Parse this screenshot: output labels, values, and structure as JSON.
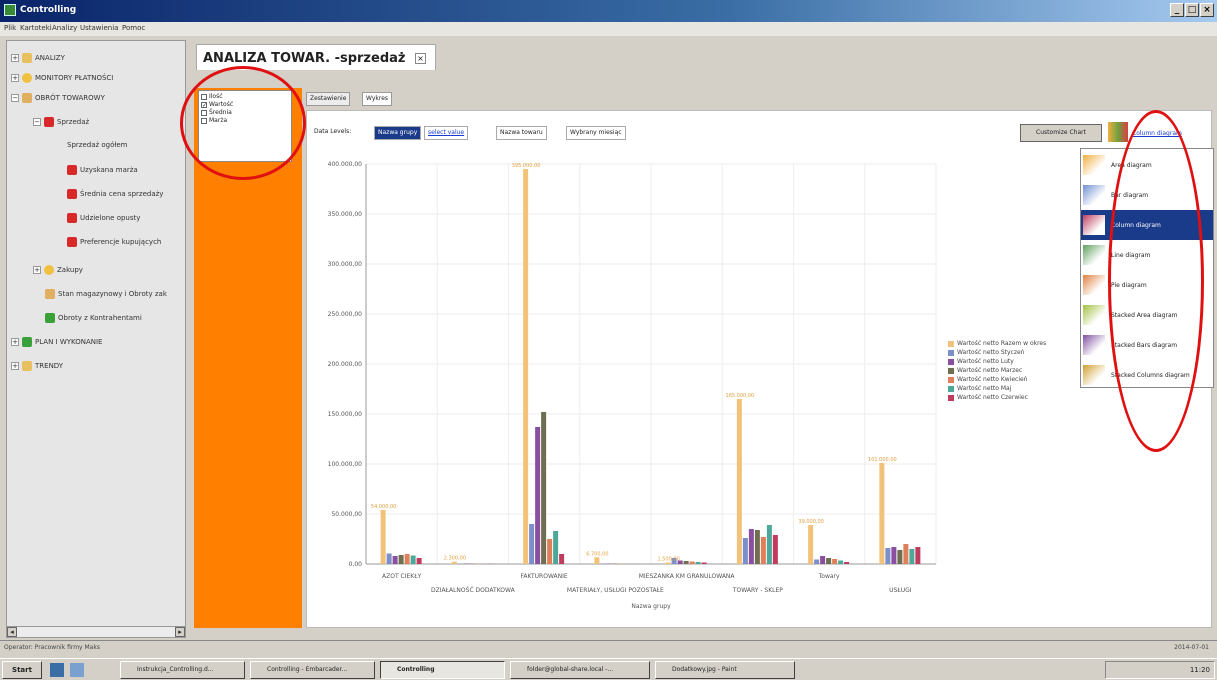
{
  "window": {
    "title": "Controlling",
    "min": "_",
    "max": "□",
    "close": "×"
  },
  "menu": [
    "Plik",
    "Kartoteki",
    "Analizy",
    "Ustawienia",
    "Pomoc"
  ],
  "tree": [
    {
      "label": "ANALIZY",
      "level": 0,
      "expand": "+",
      "icon": "chart"
    },
    {
      "label": "MONITORY PŁATNOŚCI",
      "level": 0,
      "expand": "+",
      "icon": "yellow"
    },
    {
      "label": "OBRÓT TOWAROWY",
      "level": 0,
      "expand": "−",
      "icon": "box"
    },
    {
      "label": "Sprzedaż",
      "level": 1,
      "expand": "−",
      "icon": "red"
    },
    {
      "label": "Sprzedaż ogółem",
      "level": 2,
      "expand": "",
      "icon": ""
    },
    {
      "label": "Uzyskana marża",
      "level": 2,
      "expand": "",
      "icon": "red"
    },
    {
      "label": "Średnia cena sprzedaży",
      "level": 2,
      "expand": "",
      "icon": "red"
    },
    {
      "label": "Udzielone opusty",
      "level": 2,
      "expand": "",
      "icon": "red"
    },
    {
      "label": "Preferencje kupujących",
      "level": 2,
      "expand": "",
      "icon": "red"
    },
    {
      "label": "Zakupy",
      "level": 1,
      "expand": "+",
      "icon": "yellow"
    },
    {
      "label": "Stan magazynowy i Obroty zak",
      "level": 1,
      "expand": "",
      "icon": "box"
    },
    {
      "label": "Obroty z Kontrahentami",
      "level": 1,
      "expand": "",
      "icon": "green"
    },
    {
      "label": "PLAN I WYKONANIE",
      "level": 0,
      "expand": "+",
      "icon": "green"
    },
    {
      "label": "TRENDY",
      "level": 0,
      "expand": "+",
      "icon": "chart"
    }
  ],
  "tab": {
    "title": "ANALIZA TOWAR. -sprzedaż",
    "close": "×"
  },
  "checkboxes": [
    {
      "label": "Ilość",
      "checked": false
    },
    {
      "label": "Wartość",
      "checked": true
    },
    {
      "label": "Średnia",
      "checked": false
    },
    {
      "label": "Marża",
      "checked": false
    }
  ],
  "subtabs": [
    "Zestawienie",
    "Wykres"
  ],
  "datalevels": {
    "label": "Data Levels:",
    "buttons": [
      "Nazwa grupy",
      "select value",
      "Nazwa towaru",
      "Wybrany miesiąc"
    ]
  },
  "customize_label": "Customize Chart",
  "column_diagram_label": "Column diagram",
  "diagram_menu": [
    {
      "label": "Area diagram",
      "selected": false
    },
    {
      "label": "Bar diagram",
      "selected": false
    },
    {
      "label": "Column diagram",
      "selected": true
    },
    {
      "label": "Line diagram",
      "selected": false
    },
    {
      "label": "Pie diagram",
      "selected": false
    },
    {
      "label": "Stacked Area diagram",
      "selected": false
    },
    {
      "label": "Stacked Bars diagram",
      "selected": false
    },
    {
      "label": "Stacked Columns diagram",
      "selected": false
    }
  ],
  "chart_data": {
    "type": "bar",
    "xlabel": "Nazwa grupy",
    "ylabel": "",
    "ylim": [
      0,
      400000
    ],
    "yticks": [
      "0,00",
      "50.000,00",
      "100.000,00",
      "150.000,00",
      "200.000,00",
      "250.000,00",
      "300.000,00",
      "350.000,00",
      "400.000,00"
    ],
    "categories": [
      "AZOT CIEKŁY",
      "DZIAŁALNOŚĆ DODATKOWA",
      "FAKTUROWANIE",
      "MATERIAŁY, USŁUGI POZOSTAŁE",
      "MIESZANKA KM GRANULOWANA",
      "TOWARY - SKLEP",
      "Towary",
      "USŁUGI"
    ],
    "series": [
      {
        "name": "Wartość netto Razem w okres",
        "color": "#f2c27a",
        "values": [
          54000,
          2300,
          395000,
          6700,
          1500,
          165000,
          39000,
          101000
        ]
      },
      {
        "name": "Wartość netto Styczeń",
        "color": "#7b8fc8",
        "values": [
          10500,
          500,
          40000,
          500,
          6000,
          26000,
          4500,
          16000
        ]
      },
      {
        "name": "Wartość netto Luty",
        "color": "#8a4fa0",
        "values": [
          8000,
          400,
          137000,
          400,
          3500,
          35000,
          8000,
          17000
        ]
      },
      {
        "name": "Wartość netto Marzec",
        "color": "#6e6e50",
        "values": [
          9000,
          300,
          152000,
          300,
          3000,
          34000,
          6000,
          14000
        ]
      },
      {
        "name": "Wartość netto Kwiecień",
        "color": "#e0805a",
        "values": [
          10000,
          300,
          25000,
          200,
          2500,
          27000,
          5000,
          20000
        ]
      },
      {
        "name": "Wartość netto Maj",
        "color": "#4ea899",
        "values": [
          8500,
          200,
          33000,
          200,
          2000,
          39000,
          3500,
          15000
        ]
      },
      {
        "name": "Wartość netto Czerwiec",
        "color": "#c03c5e",
        "values": [
          6000,
          200,
          10000,
          100,
          1500,
          29000,
          2000,
          17000
        ]
      }
    ],
    "data_labels": [
      {
        "text": "54.000,00"
      },
      {
        "text": "2.300,00"
      },
      {
        "text": "395.000,00"
      },
      {
        "text": "6.700,00"
      },
      {
        "text": "1.500,00"
      },
      {
        "text": "165.000,00"
      },
      {
        "text": "39.000,00"
      },
      {
        "text": "101.000,00"
      }
    ]
  },
  "status": {
    "operator": "Operator: Pracownik firmy Maks",
    "date": "2014-07-01"
  },
  "taskbar": {
    "start": "Start",
    "buttons": [
      {
        "label": "Instrukcja_Controlling.d...",
        "active": false
      },
      {
        "label": "Controlling - Embarcader...",
        "active": false
      },
      {
        "label": "Controlling",
        "active": true
      },
      {
        "label": "folder@global-share.local -...",
        "active": false
      },
      {
        "label": "Dodatkowy.jpg - Paint",
        "active": false
      }
    ],
    "clock": "11:20"
  }
}
